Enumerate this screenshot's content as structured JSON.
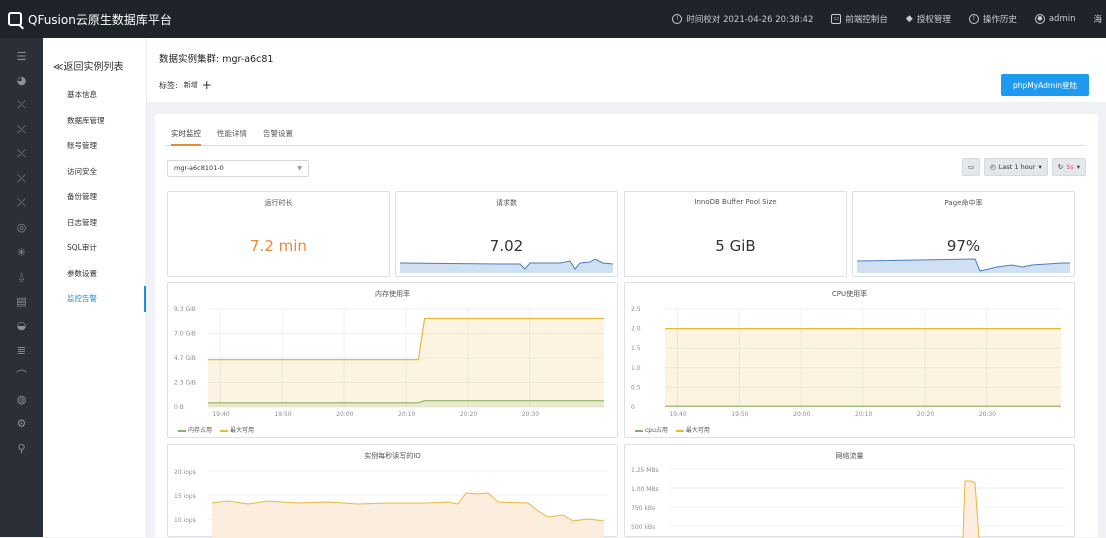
{
  "app": {
    "title": "QFusion云原生数据库平台",
    "server_time": "时间校对 2021-04-26 20:38:42",
    "topnav": [
      "前端控制台",
      "授权管理",
      "操作历史"
    ],
    "user": "admin",
    "tail_text": "海"
  },
  "subnav": {
    "back_label": "≪返回实例列表",
    "items": [
      "基本信息",
      "数据库管理",
      "账号管理",
      "访问安全",
      "备份管理",
      "日志管理",
      "SQL审计",
      "参数设置",
      "监控告警"
    ],
    "active_index": 8
  },
  "header": {
    "cluster_title": "数据实例集群: mgr-a6c81",
    "tag_label": "标签:",
    "tag_new": "新增",
    "tag_plus": "+",
    "phpmyadmin_button": "phpMyAdmin登陆"
  },
  "tabs": [
    "实时监控",
    "性能详情",
    "告警设置"
  ],
  "active_tab": 0,
  "toolbar": {
    "instance_select": "mgr-a6c8101-0",
    "time_range": "Last 1 hour",
    "refresh": "5s"
  },
  "stats": [
    {
      "title": "运行时长",
      "value": "7.2 min",
      "color": "#ea8a35",
      "spark": false
    },
    {
      "title": "请求数",
      "value": "7.02",
      "color": "#333333",
      "spark": true
    },
    {
      "title": "InnoDB Buffer Pool Size",
      "value": "5 GiB",
      "color": "#333333",
      "spark": false
    },
    {
      "title": "Page命中率",
      "value": "97%",
      "color": "#333333",
      "spark": true
    }
  ],
  "charts": {
    "memory": {
      "title": "内存使用率",
      "y_ticks": [
        "9.3 GiB",
        "7.0 GiB",
        "4.7 GiB",
        "2.3 GiB",
        "0 B"
      ],
      "x_ticks": [
        "19:40",
        "19:50",
        "20:00",
        "20:10",
        "20:20",
        "20:30"
      ],
      "legend": [
        "内存占用",
        "最大可用"
      ]
    },
    "cpu": {
      "title": "CPU使用率",
      "y_ticks": [
        "2.5",
        "2.0",
        "1.5",
        "1.0",
        "0.5",
        "0"
      ],
      "x_ticks": [
        "19:40",
        "19:50",
        "20:00",
        "20:10",
        "20:20",
        "20:30"
      ],
      "legend": [
        "cpu占用",
        "最大可用"
      ]
    },
    "iops": {
      "title": "实例每秒读写的IO",
      "y_ticks": [
        "20 iops",
        "15 iops",
        "10 iops"
      ]
    },
    "network": {
      "title": "网络流量",
      "y_ticks": [
        "1.25 MBs",
        "1.00 MBs",
        "750 kBs",
        "500 kBs"
      ]
    }
  },
  "chart_data": [
    {
      "type": "line",
      "title": "内存使用率",
      "x": [
        "19:38",
        "20:12",
        "20:13",
        "20:42"
      ],
      "series": [
        {
          "name": "内存占用",
          "values": [
            0.4,
            0.4,
            0.6,
            0.6
          ],
          "color": "#7eb26d"
        },
        {
          "name": "最大可用",
          "values": [
            4.5,
            4.5,
            8.4,
            8.4
          ],
          "color": "#eab839"
        }
      ],
      "ylim": [
        0,
        9.3
      ]
    },
    {
      "type": "line",
      "title": "CPU使用率",
      "x": [
        "19:38",
        "20:42"
      ],
      "series": [
        {
          "name": "cpu占用",
          "values": [
            0.02,
            0.02
          ],
          "color": "#7eb26d"
        },
        {
          "name": "最大可用",
          "values": [
            2.0,
            2.0
          ],
          "color": "#eab839"
        }
      ],
      "ylim": [
        0,
        2.5
      ]
    }
  ],
  "colors": {
    "accent": "#1f8fdc",
    "topbar": "#1f242b",
    "rail": "#2b3038",
    "orange": "#ea8a35",
    "green": "#7eb26d",
    "yellow": "#eab839"
  }
}
